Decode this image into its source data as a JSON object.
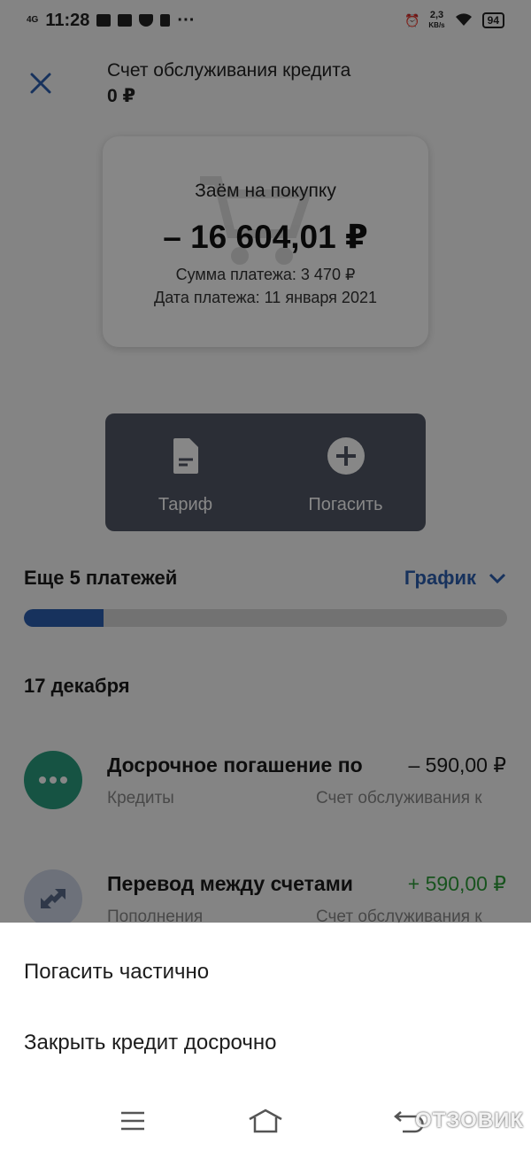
{
  "status_bar": {
    "network": "4G",
    "time": "11:28",
    "speed_value": "2,3",
    "speed_unit": "KB/s",
    "battery": "94"
  },
  "header": {
    "title": "Счет обслуживания кредита",
    "balance": "0 ₽"
  },
  "loan_card": {
    "title": "Заём на покупку",
    "amount": "– 16 604,01 ₽",
    "payment_sum": "Сумма платежа: 3 470 ₽",
    "payment_date": "Дата платежа: 11 января 2021"
  },
  "actions": [
    {
      "label": "Тариф",
      "icon": "document-icon"
    },
    {
      "label": "Погасить",
      "icon": "plus-circle-icon"
    }
  ],
  "payments": {
    "remaining_label": "Еще 5 платежей",
    "schedule_label": "График",
    "progress": 0.165
  },
  "transactions_date": "17 декабря",
  "transactions": [
    {
      "name": "Досрочное погашение по",
      "amount": "– 590,00 ₽",
      "category": "Кредиты",
      "account": "Счет обслуживания к",
      "icon": "more-dots-icon",
      "icon_color": "#2a9d7f",
      "amount_color": "#1c1c1c"
    },
    {
      "name": "Перевод между счетами",
      "amount": "+ 590,00 ₽",
      "category": "Пополнения",
      "account": "Счет обслуживания к",
      "icon": "transfer-arrows-icon",
      "icon_color": "#cfd6e6",
      "amount_color": "#2e9e3a"
    }
  ],
  "bottom_sheet": {
    "items": [
      "Погасить частично",
      "Закрыть кредит досрочно"
    ]
  },
  "watermark": "ОТЗОВИК",
  "colors": {
    "accent": "#2d5fb0",
    "overlay": "rgba(0,0,0,0.47)"
  }
}
